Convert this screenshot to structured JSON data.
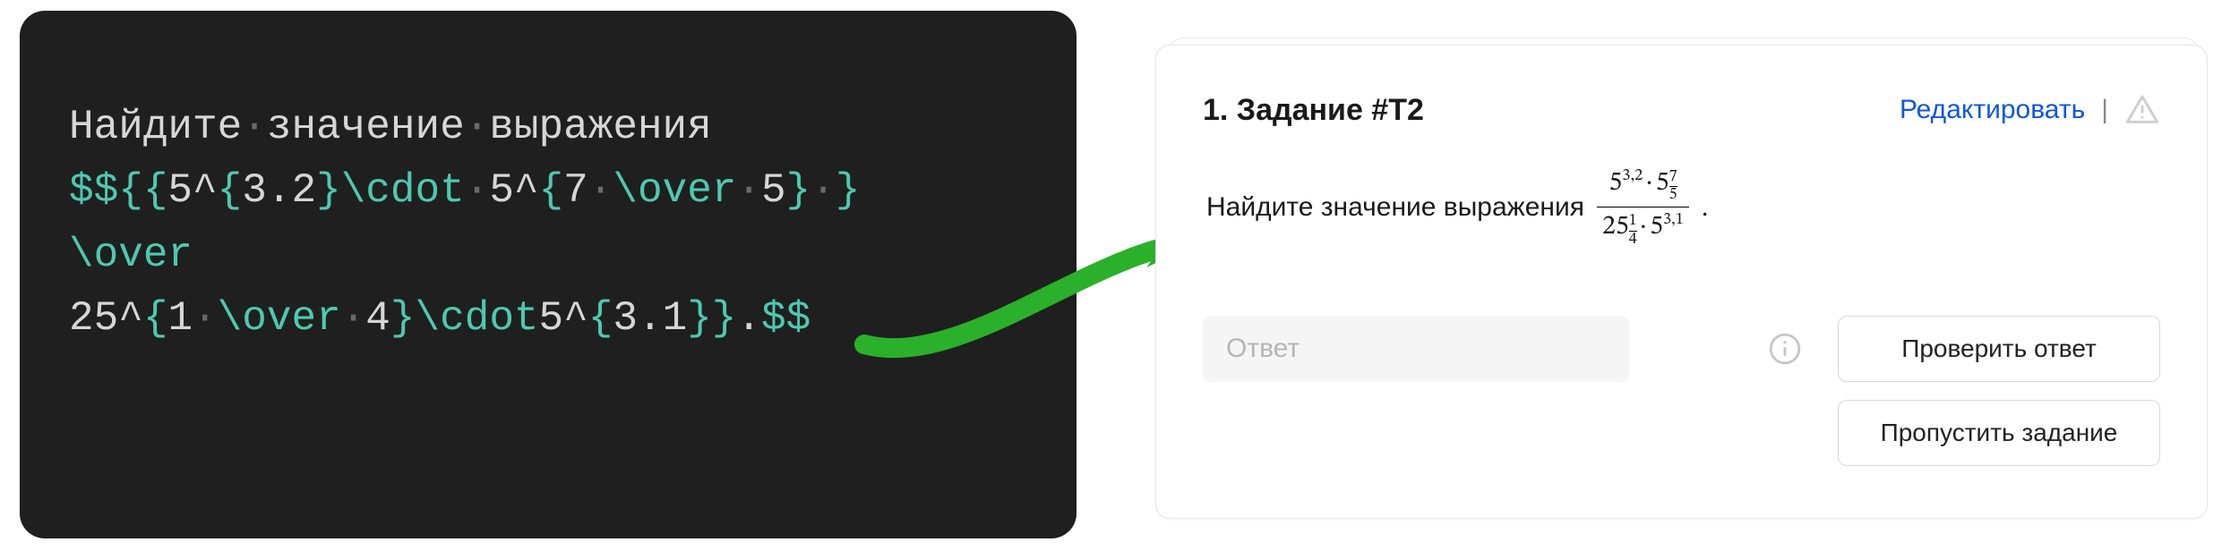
{
  "code": {
    "line1_plain": "Найдите·значение·выражения",
    "latex_source": "$${{5^{3.2}\\cdot 5^{7 \\over 5} }\\over 25^{1 \\over 4}\\cdot5^{3.1}}.$$"
  },
  "card": {
    "title": "1. Задание #T2",
    "edit": "Редактировать",
    "problem_text": "Найдите значение выражения",
    "formula": {
      "num_base1": "5",
      "num_exp1": "3,2",
      "num_base2": "5",
      "num_exp2_top": "7",
      "num_exp2_bot": "5",
      "den_base1": "25",
      "den_exp1_top": "1",
      "den_exp1_bot": "4",
      "den_base2": "5",
      "den_exp2": "3,1",
      "trailing": "."
    },
    "answer_placeholder": "Ответ",
    "btn_check": "Проверить ответ",
    "btn_skip": "Пропустить задание"
  },
  "icons": {
    "info": "info-icon",
    "warn": "warning-icon",
    "arrow": "arrow-right-icon"
  }
}
